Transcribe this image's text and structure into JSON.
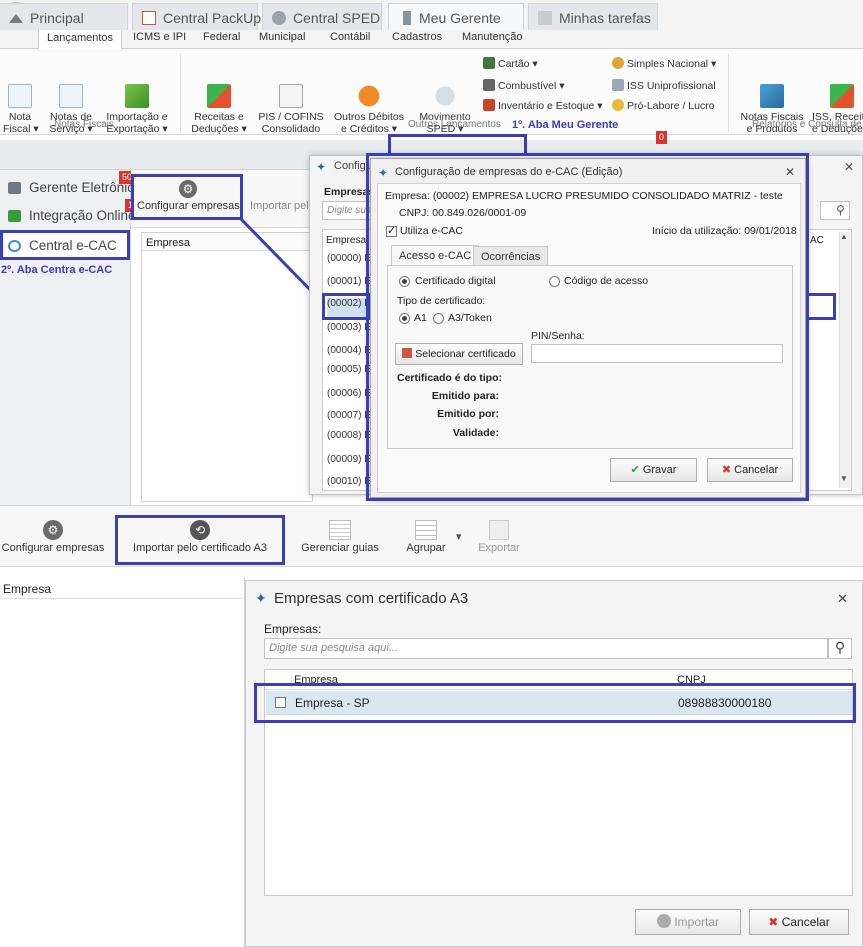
{
  "app": {
    "title": "Alterdata Fiscal"
  },
  "ribbon": {
    "tabs": [
      "Lançamentos",
      "ICMS e IPI",
      "Federal",
      "Municipal",
      "Contábil",
      "Cadastros",
      "Manutenção"
    ],
    "buttons": {
      "nota_fiscal": "Nota\nFiscal ▾",
      "notas_servico": "Notas de\nServiço ▾",
      "importacao": "Importação e\nExportação ▾",
      "receitas": "Receitas e\nDeduções ▾",
      "pis_cofins": "PIS / COFINS\nConsolidado",
      "outros_debitos": "Outros Débitos\ne Créditos ▾",
      "movimento_sped": "Movimento\nSPED ▾",
      "notas_fiscais_produtos": "Notas Fiscais\ne Produtos",
      "iss_receitas": "ISS, Receitas\ne Deduções"
    },
    "small": {
      "cartao": "Cartão ▾",
      "combustivel": "Combustível ▾",
      "inventario": "Inventário e Estoque ▾",
      "simples": "Simples Nacional ▾",
      "iss_uni": "ISS Uniprofissional",
      "pro_labore": "Pró-Labore / Lucro"
    },
    "groups": {
      "notas_fiscais": "Notas Fiscais",
      "outros_lancamentos": "Outros Lançamentos",
      "relatorios": "Relatórios e Consulta de"
    }
  },
  "annotations": {
    "aba_meu_gerente": "1º. Aba Meu Gerente",
    "aba_central": "2º. Aba Centra e-CAC"
  },
  "module_tabs": {
    "principal": "Principal",
    "central_packup": "Central PackUp",
    "central_sped": "Central SPED Dpiof",
    "meu_gerente": "Meu Gerente",
    "minhas_tarefas": "Minhas tarefas",
    "badge": "0"
  },
  "left_nav": {
    "gerente": "Gerente Eletrônico",
    "gerente_badge": "50",
    "integracao": "Integração Online",
    "integracao_badge": "1",
    "central": "Central e-CAC"
  },
  "toolbar_top": {
    "configurar": "Configurar empresas",
    "importar": "Importar pelo"
  },
  "grid_top": {
    "header": "Empresa"
  },
  "dialog_back": {
    "title": "Configu",
    "empresas_label": "Empresas",
    "search_placeholder": "Digite sua",
    "col_empresa": "Empresa",
    "col_cac": "AC",
    "rows": [
      "(00000) E",
      "(00001) E",
      "(00002) E",
      "(00003) E",
      "(00004) E",
      "(00005) E",
      "(00006) E",
      "(00007) E",
      "(00008) E",
      "(00009) E",
      "(00010) E"
    ]
  },
  "dialog_config": {
    "title": "Configuração de empresas do e-CAC (Edição)",
    "empresa": "Empresa: (00002) EMPRESA LUCRO PRESUMIDO CONSOLIDADO MATRIZ - teste",
    "cnpj": "CNPJ: 00.849.026/0001-09",
    "utiliza": "Utiliza e-CAC",
    "inicio": "Início da utilização: 09/01/2018",
    "tab_acesso": "Acesso e-CAC",
    "tab_ocorrencias": "Ocorrências",
    "opt_certificado": "Certificado digital",
    "opt_codigo": "Código de acesso",
    "tipo_label": "Tipo de certificado:",
    "opt_a1": "A1",
    "opt_a3": "A3/Token",
    "pin_label": "PIN/Senha:",
    "selecionar": "Selecionar certificado",
    "cert_tipo": "Certificado é do tipo:",
    "emitido_para": "Emitido para:",
    "emitido_por": "Emitido por:",
    "validade": "Validade:",
    "gravar": "Gravar",
    "cancelar": "Cancelar"
  },
  "toolbar_bottom": {
    "configurar": "Configurar empresas",
    "importar": "Importar pelo certificado A3",
    "gerenciar": "Gerenciar guias",
    "agrupar": "Agrupar",
    "exportar": "Exportar"
  },
  "lower_grid": {
    "header": "Empresa"
  },
  "dialog_a3": {
    "title": "Empresas com certificado A3",
    "empresas_label": "Empresas:",
    "search_placeholder": "Digite sua pesquisa aqui...",
    "col_empresa": "Empresa",
    "col_cnpj": "CNPJ",
    "row_empresa": "Empresa - SP",
    "row_cnpj": "08988830000180",
    "importar": "Importar",
    "cancelar": "Cancelar"
  },
  "colors": {
    "highlight": "#3a3fb8",
    "badge": "#d9362b",
    "selected_row": "#d9e7f3"
  }
}
